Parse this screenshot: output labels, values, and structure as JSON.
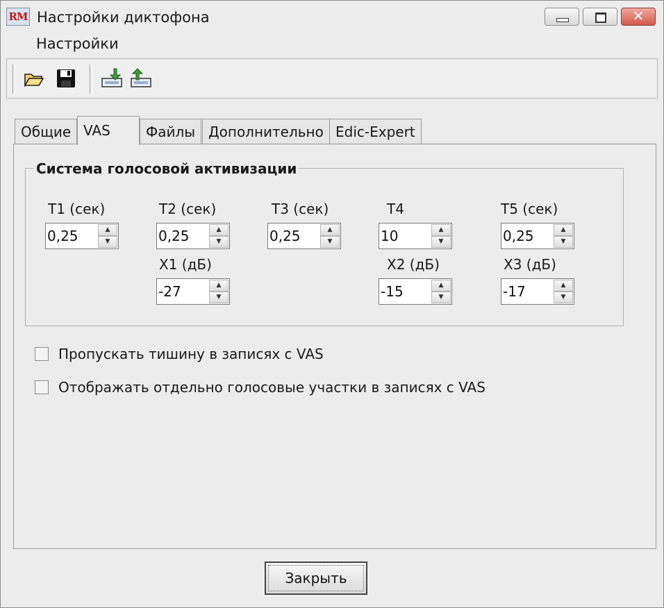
{
  "window": {
    "app_icon_text": "RM",
    "title": "Настройки диктофона",
    "close_glyph": "✕"
  },
  "menu": {
    "items": [
      "Настройки"
    ]
  },
  "toolbar": {
    "icons": [
      "open-folder-icon",
      "save-disk-icon",
      "import-icon",
      "export-icon"
    ]
  },
  "tabs": [
    {
      "label": "Общие",
      "active": false
    },
    {
      "label": "VAS",
      "active": true
    },
    {
      "label": "Файлы",
      "active": false
    },
    {
      "label": "Дополнительно",
      "active": false
    },
    {
      "label": "Edic-Expert",
      "active": false
    }
  ],
  "vas_group": {
    "title": "Система голосовой активизации",
    "t1": {
      "label": "T1 (сек)",
      "value": "0,25"
    },
    "t2": {
      "label": "T2 (сек)",
      "value": "0,25"
    },
    "t3": {
      "label": "T3 (сек)",
      "value": "0,25"
    },
    "t4": {
      "label": "T4",
      "value": "10"
    },
    "t5": {
      "label": "T5 (сек)",
      "value": "0,25"
    },
    "x1": {
      "label": "X1 (дБ)",
      "value": "-27"
    },
    "x2": {
      "label": "X2 (дБ)",
      "value": "-15"
    },
    "x3": {
      "label": "X3 (дБ)",
      "value": "-17"
    }
  },
  "checkboxes": [
    {
      "label": "Пропускать тишину в записях с VAS",
      "checked": false
    },
    {
      "label": "Отображать отдельно голосовые участки в записях с VAS",
      "checked": false
    }
  ],
  "spin": {
    "up": "▲",
    "down": "▼"
  },
  "footer": {
    "close_label": "Закрыть"
  }
}
